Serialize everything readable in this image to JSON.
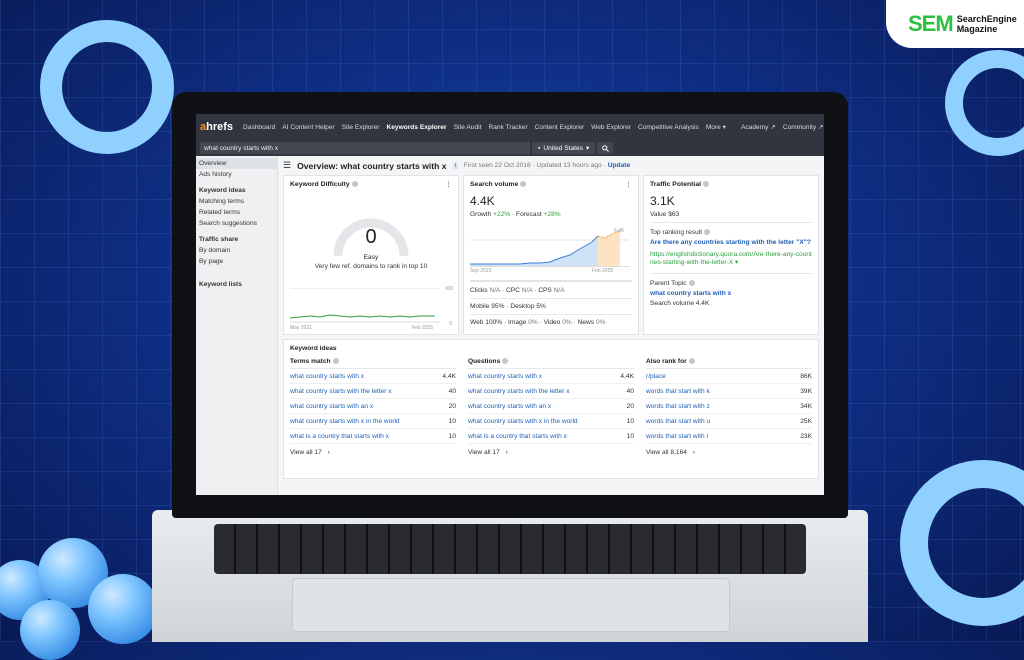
{
  "branding": {
    "logo_main": "SEM",
    "logo_sub_1": "SearchEngine",
    "logo_sub_2": "Magazine"
  },
  "app": {
    "brand_a": "a",
    "brand_rest": "hrefs",
    "nav": [
      "Dashboard",
      "AI Content Helper",
      "Site Explorer",
      "Keywords Explorer",
      "Site Audit",
      "Rank Tracker",
      "Content Explorer",
      "Web Explorer",
      "Competitive Analysis",
      "More ▾",
      "Academy ↗",
      "Community ↗"
    ],
    "search": {
      "value": "what country starts with x",
      "country": "United States"
    },
    "sidebar": {
      "overview": "Overview",
      "ads_history": "Ads history",
      "keyword_ideas": "Keyword ideas",
      "matching": "Matching terms",
      "related": "Related terms",
      "suggestions": "Search suggestions",
      "traffic_share": "Traffic share",
      "by_domain": "By domain",
      "by_page": "By page",
      "keyword_lists": "Keyword lists"
    },
    "overview": {
      "title": "Overview: what country starts with x",
      "meta": "First seen 22 Oct 2016 · Updated 13 hours ago ·",
      "update": "Update"
    },
    "kd": {
      "title": "Keyword Difficulty",
      "value": "0",
      "label": "Easy",
      "desc": "Very few ref. domains to rank in top 10",
      "axis_start": "May 2021",
      "axis_end": "Feb 2025",
      "y_top": "100",
      "y_bottom": "0"
    },
    "sv": {
      "title": "Search volume",
      "value": "4.4K",
      "growth_label": "Growth",
      "growth": "+22%",
      "forecast_label": "Forecast",
      "forecast": "+28%",
      "peak": "6.4K",
      "axis_start": "Sep 2015",
      "axis_end": "Feb 2025",
      "clicks": "Clicks",
      "cpc": "CPC",
      "cps": "CPS",
      "na": "N/A",
      "mobile": "Mobile 95%",
      "desktop": "Desktop 5%",
      "web": "Web 100%",
      "image": "Image",
      "video": "Video",
      "news": "News",
      "zero": "0%"
    },
    "tp": {
      "title": "Traffic Potential",
      "value": "3.1K",
      "value_label": "Value $63",
      "top_label": "Top ranking result",
      "top_title": "Are there any countries starting with the letter \"X\"?",
      "top_url": "https://englishdictionary.quora.com/Are-there-any-countries-starting-with-the-letter-X ▾",
      "parent_label": "Parent Topic",
      "parent": "what country starts with x",
      "parent_sv": "Search volume 4.4K"
    },
    "kw": {
      "title": "Keyword ideas",
      "terms": {
        "title": "Terms match",
        "rows": [
          [
            "what country starts with x",
            "4.4K"
          ],
          [
            "what country starts with the letter x",
            "40"
          ],
          [
            "what country starts with an x",
            "20"
          ],
          [
            "what country starts with x in the world",
            "10"
          ],
          [
            "what is a country that starts with x",
            "10"
          ]
        ],
        "view": "View all 17"
      },
      "questions": {
        "title": "Questions",
        "rows": [
          [
            "what country starts with x",
            "4.4K"
          ],
          [
            "what country starts with the letter x",
            "40"
          ],
          [
            "what country starts with an x",
            "20"
          ],
          [
            "what country starts with x in the world",
            "10"
          ],
          [
            "what is a country that starts with x",
            "10"
          ]
        ],
        "view": "View all 17"
      },
      "also": {
        "title": "Also rank for",
        "rows": [
          [
            "r/place",
            "86K"
          ],
          [
            "words that start with k",
            "39K"
          ],
          [
            "words that start with z",
            "34K"
          ],
          [
            "words that start with u",
            "25K"
          ],
          [
            "words that start with l",
            "23K"
          ]
        ],
        "view": "View all 8,164"
      }
    }
  }
}
